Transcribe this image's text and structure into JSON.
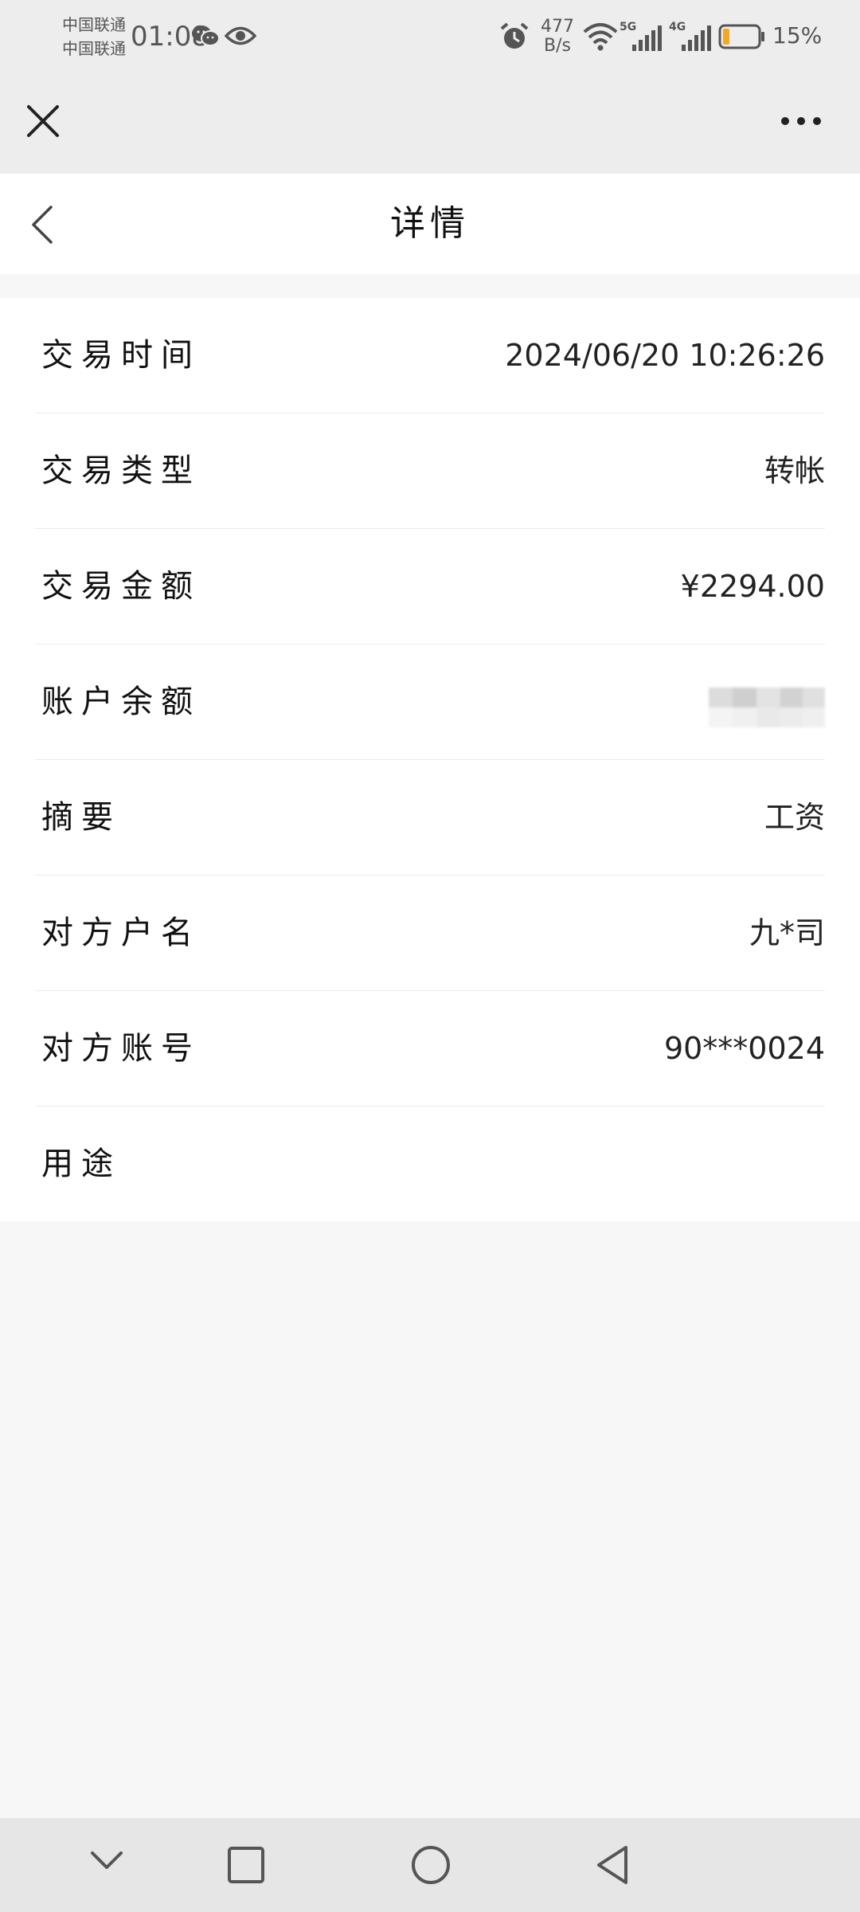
{
  "status_bar": {
    "carrier_1": "中国联通",
    "carrier_2": "中国联通",
    "time": "01:08",
    "net_speed_value": "477",
    "net_speed_unit": "B/s",
    "signal_1": "5G",
    "signal_2": "4G",
    "battery": "15%",
    "battery_level": 0.15,
    "battery_color": "#f5a623",
    "icons": [
      "wechat-icon",
      "eye-icon",
      "alarm-icon",
      "wifi-icon",
      "signal-icon",
      "battery-icon"
    ]
  },
  "app_bar": {
    "icons": [
      "close-icon",
      "more-icon"
    ]
  },
  "header": {
    "title": "详情",
    "icons": [
      "back-icon"
    ]
  },
  "details": [
    {
      "label": "交易时间",
      "value": "2024/06/20 10:26:26"
    },
    {
      "label": "交易类型",
      "value": "转帐"
    },
    {
      "label": "交易金额",
      "value": "¥2294.00"
    },
    {
      "label": "账户余额",
      "value": ""
    },
    {
      "label": "摘要",
      "value": "工资"
    },
    {
      "label": "对方户名",
      "value": "九*司"
    },
    {
      "label": "对方账号",
      "value": "90***0024"
    },
    {
      "label": "用途",
      "value": ""
    }
  ],
  "nav_bar": {
    "icons": [
      "nav-down-icon",
      "nav-recents-icon",
      "nav-home-icon",
      "nav-back-icon"
    ]
  }
}
